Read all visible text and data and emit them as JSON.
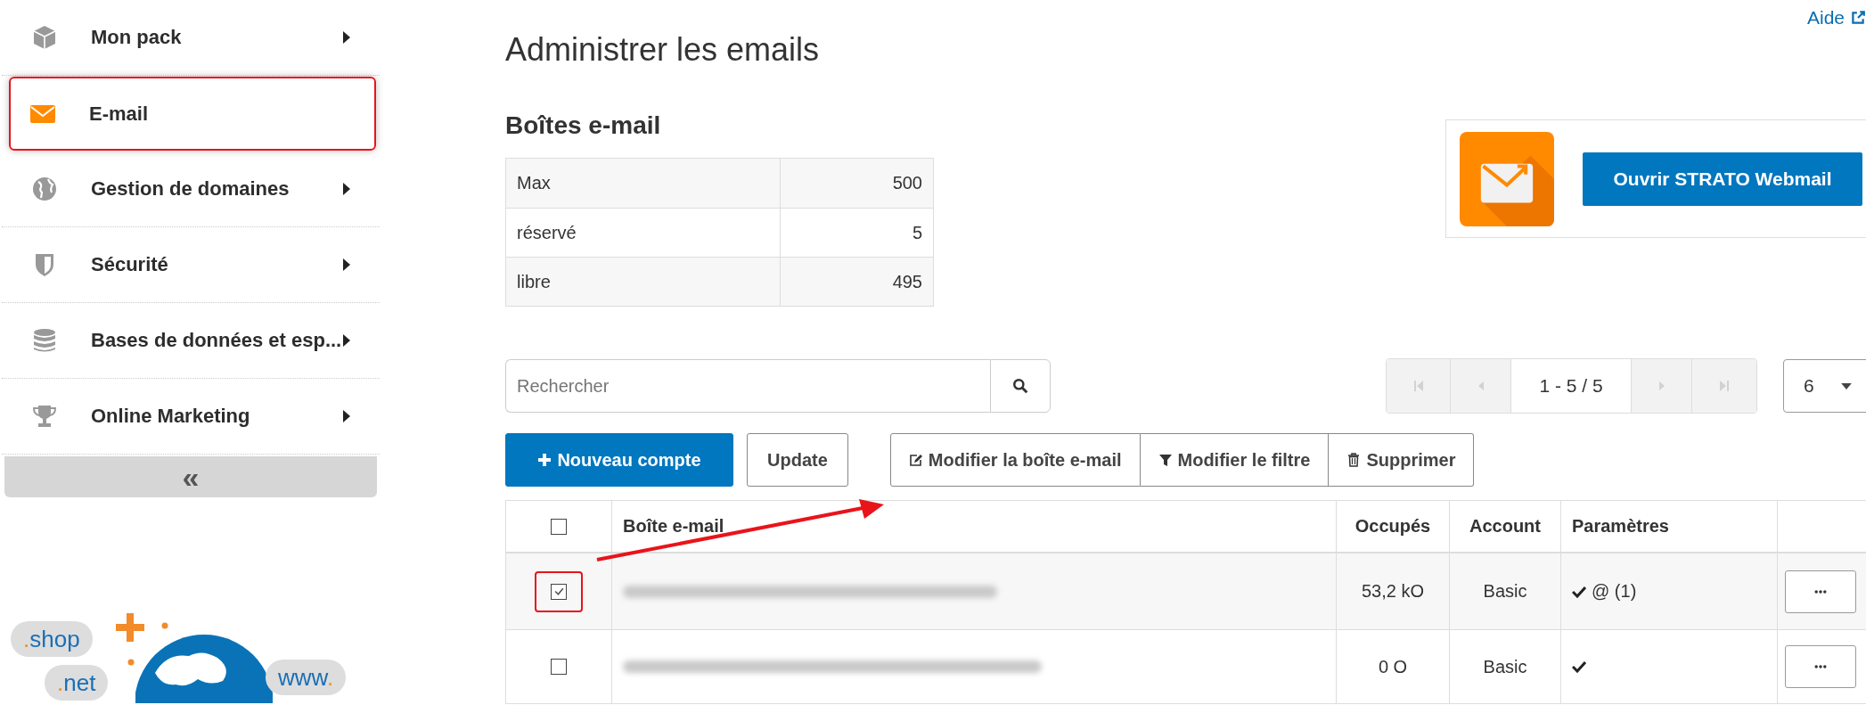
{
  "sidebar": {
    "items": [
      {
        "label": "Mon pack",
        "selected": false,
        "has_submenu": true,
        "marked": false
      },
      {
        "label": "E-mail",
        "selected": true,
        "has_submenu": false,
        "marked": true
      },
      {
        "label": "Gestion de domaines",
        "selected": false,
        "has_submenu": true,
        "marked": false
      },
      {
        "label": "Sécurité",
        "selected": false,
        "has_submenu": true,
        "marked": false
      },
      {
        "label": "Bases de données et esp...",
        "selected": false,
        "has_submenu": true,
        "marked": false
      },
      {
        "label": "Online Marketing",
        "selected": false,
        "has_submenu": true,
        "marked": false
      }
    ],
    "collapse_label": "«"
  },
  "promo": {
    "tags": [
      {
        "prefix": ".",
        "text": "shop"
      },
      {
        "prefix": ".",
        "text": "net"
      },
      {
        "text": "www",
        "suffix": "."
      }
    ]
  },
  "help_link": "Aide",
  "page_title": "Administrer les emails",
  "section_title": "Boîtes e-mail",
  "stats": [
    {
      "label": "Max",
      "value": "500"
    },
    {
      "label": "réservé",
      "value": "5"
    },
    {
      "label": "libre",
      "value": "495"
    }
  ],
  "webmail_button": "Ouvrir STRATO Webmail",
  "search": {
    "placeholder": "Rechercher"
  },
  "pagination": {
    "nav": [
      {
        "kind": "first",
        "disabled": true
      },
      {
        "kind": "prev",
        "disabled": true
      },
      {
        "kind": "next",
        "disabled": true
      },
      {
        "kind": "last",
        "disabled": true
      }
    ],
    "range": "1 - 5 / 5",
    "per_page": "6"
  },
  "actions": [
    {
      "label": "Nouveau compte",
      "kind": "add",
      "group": false
    },
    {
      "label": "Update",
      "kind": "update",
      "group": false
    },
    {
      "label": "Modifier la boîte e-mail",
      "kind": "edit",
      "group": true
    },
    {
      "label": "Modifier le filtre",
      "kind": "filter",
      "group": true
    },
    {
      "label": "Supprimer",
      "kind": "delete",
      "group": true
    }
  ],
  "table": {
    "header_checked": false,
    "columns": [
      "Boîte e-mail",
      "Occupés",
      "Account",
      "Paramètres"
    ],
    "rows": [
      {
        "checked": true,
        "marked": true,
        "size": "53,2 kO",
        "account": "Basic",
        "active": true,
        "extra": "@ (1)"
      },
      {
        "checked": false,
        "marked": false,
        "size": "0 O",
        "account": "Basic",
        "active": true
      }
    ]
  },
  "annotation_arrow": true
}
